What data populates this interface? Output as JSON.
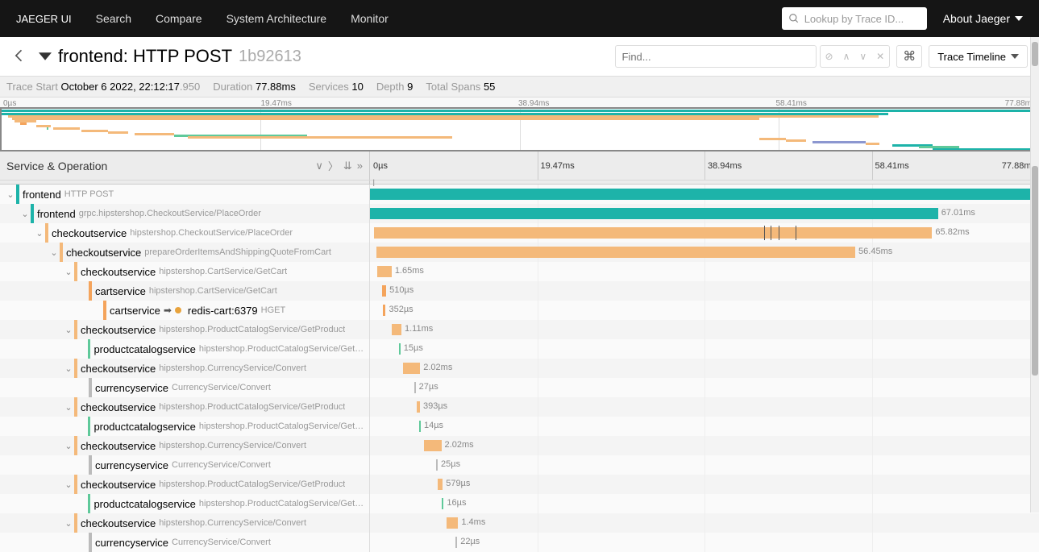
{
  "nav": {
    "brand": "JAEGER UI",
    "items": [
      "Search",
      "Compare",
      "System Architecture",
      "Monitor"
    ],
    "lookup_placeholder": "Lookup by Trace ID...",
    "about": "About Jaeger"
  },
  "header": {
    "title": "frontend: HTTP POST",
    "trace_id": "1b92613",
    "find_placeholder": "Find...",
    "view_mode": "Trace Timeline"
  },
  "info": {
    "start_label": "Trace Start",
    "start_value": "October 6 2022, 22:12:17",
    "start_ms": ".950",
    "duration_label": "Duration",
    "duration_value": "77.88ms",
    "services_label": "Services",
    "services_value": "10",
    "depth_label": "Depth",
    "depth_value": "9",
    "spans_label": "Total Spans",
    "spans_value": "55"
  },
  "ticks": [
    "0µs",
    "19.47ms",
    "38.94ms",
    "58.41ms",
    "77.88ms"
  ],
  "left_header": "Service & Operation",
  "colors": {
    "teal": "#1db3a9",
    "orange": "#f4b97a",
    "orange2": "#f4a45c",
    "green": "#5fc99a",
    "grey": "#bbb"
  },
  "chart_data": {
    "type": "gantt",
    "x_unit": "ms",
    "x_range": [
      0,
      77.88
    ],
    "spans": [
      {
        "indent": 0,
        "service": "frontend",
        "op": "HTTP POST",
        "color": "teal",
        "start": 0,
        "dur": 77.88,
        "label": ""
      },
      {
        "indent": 1,
        "service": "frontend",
        "op": "grpc.hipstershop.CheckoutService/PlaceOrder",
        "color": "teal",
        "start": 0,
        "dur": 67.01,
        "label": "67.01ms"
      },
      {
        "indent": 2,
        "service": "checkoutservice",
        "op": "hipstershop.CheckoutService/PlaceOrder",
        "color": "orange",
        "start": 0.5,
        "dur": 65.82,
        "label": "65.82ms",
        "logs": [
          46.5,
          47.3,
          48.2,
          50.2
        ]
      },
      {
        "indent": 3,
        "service": "checkoutservice",
        "op": "prepareOrderItemsAndShippingQuoteFromCart",
        "color": "orange",
        "start": 0.8,
        "dur": 56.45,
        "label": "56.45ms"
      },
      {
        "indent": 4,
        "service": "checkoutservice",
        "op": "hipstershop.CartService/GetCart",
        "color": "orange",
        "start": 0.9,
        "dur": 1.65,
        "label": "1.65ms"
      },
      {
        "indent": 5,
        "service": "cartservice",
        "op": "hipstershop.CartService/GetCart",
        "color": "orange2",
        "start": 1.4,
        "dur": 0.51,
        "label": "510µs"
      },
      {
        "indent": 6,
        "service": "cartservice",
        "op": "HGET",
        "color": "orange2",
        "link": "redis-cart:6379",
        "start": 1.5,
        "dur": 0.352,
        "label": "352µs"
      },
      {
        "indent": 4,
        "service": "checkoutservice",
        "op": "hipstershop.ProductCatalogService/GetProduct",
        "color": "orange",
        "start": 2.6,
        "dur": 1.11,
        "label": "1.11ms"
      },
      {
        "indent": 5,
        "service": "productcatalogservice",
        "op": "hipstershop.ProductCatalogService/GetProduct",
        "color": "green",
        "start": 3.4,
        "dur": 0.015,
        "label": "15µs"
      },
      {
        "indent": 4,
        "service": "checkoutservice",
        "op": "hipstershop.CurrencyService/Convert",
        "color": "orange",
        "start": 3.9,
        "dur": 2.02,
        "label": "2.02ms"
      },
      {
        "indent": 5,
        "service": "currencyservice",
        "op": "CurrencyService/Convert",
        "color": "grey",
        "start": 5.2,
        "dur": 0.027,
        "label": "27µs"
      },
      {
        "indent": 4,
        "service": "checkoutservice",
        "op": "hipstershop.ProductCatalogService/GetProduct",
        "color": "orange",
        "start": 5.5,
        "dur": 0.393,
        "label": "393µs"
      },
      {
        "indent": 5,
        "service": "productcatalogservice",
        "op": "hipstershop.ProductCatalogService/GetProduct",
        "color": "green",
        "start": 5.8,
        "dur": 0.014,
        "label": "14µs"
      },
      {
        "indent": 4,
        "service": "checkoutservice",
        "op": "hipstershop.CurrencyService/Convert",
        "color": "orange",
        "start": 6.4,
        "dur": 2.02,
        "label": "2.02ms"
      },
      {
        "indent": 5,
        "service": "currencyservice",
        "op": "CurrencyService/Convert",
        "color": "grey",
        "start": 7.8,
        "dur": 0.025,
        "label": "25µs"
      },
      {
        "indent": 4,
        "service": "checkoutservice",
        "op": "hipstershop.ProductCatalogService/GetProduct",
        "color": "orange",
        "start": 8.0,
        "dur": 0.579,
        "label": "579µs"
      },
      {
        "indent": 5,
        "service": "productcatalogservice",
        "op": "hipstershop.ProductCatalogService/GetProduct",
        "color": "green",
        "start": 8.5,
        "dur": 0.016,
        "label": "16µs"
      },
      {
        "indent": 4,
        "service": "checkoutservice",
        "op": "hipstershop.CurrencyService/Convert",
        "color": "orange",
        "start": 9.0,
        "dur": 1.4,
        "label": "1.4ms"
      },
      {
        "indent": 5,
        "service": "currencyservice",
        "op": "CurrencyService/Convert",
        "color": "grey",
        "start": 10.1,
        "dur": 0.022,
        "label": "22µs"
      }
    ]
  },
  "minimap_spans": [
    {
      "color": "teal",
      "start": 0,
      "dur": 77.88,
      "y": 1
    },
    {
      "color": "teal",
      "start": 0,
      "dur": 67.01,
      "y": 5
    },
    {
      "color": "orange",
      "start": 0.5,
      "dur": 65.82,
      "y": 8
    },
    {
      "color": "orange",
      "start": 0.8,
      "dur": 56.45,
      "y": 11
    },
    {
      "color": "orange",
      "start": 1,
      "dur": 1.6,
      "y": 14
    },
    {
      "color": "orange2",
      "start": 1.4,
      "dur": 0.5,
      "y": 17
    },
    {
      "color": "orange",
      "start": 2.6,
      "dur": 1.1,
      "y": 20
    },
    {
      "color": "green",
      "start": 3.4,
      "dur": 0.1,
      "y": 23
    },
    {
      "color": "orange",
      "start": 3.9,
      "dur": 2,
      "y": 23
    },
    {
      "color": "orange",
      "start": 6,
      "dur": 2,
      "y": 26
    },
    {
      "color": "orange",
      "start": 8,
      "dur": 1.5,
      "y": 28
    },
    {
      "color": "orange",
      "start": 10,
      "dur": 3,
      "y": 30
    },
    {
      "color": "green",
      "start": 13,
      "dur": 10,
      "y": 32
    },
    {
      "color": "orange",
      "start": 14,
      "dur": 20,
      "y": 34
    },
    {
      "color": "orange",
      "start": 57,
      "dur": 2,
      "y": 36
    },
    {
      "color": "orange",
      "start": 59,
      "dur": 1.5,
      "y": 38
    },
    {
      "color": "#8c97d0",
      "start": 61,
      "dur": 4,
      "y": 40
    },
    {
      "color": "orange",
      "start": 65,
      "dur": 1,
      "y": 42
    },
    {
      "color": "teal",
      "start": 67,
      "dur": 3,
      "y": 44
    },
    {
      "color": "green",
      "start": 69,
      "dur": 3,
      "y": 46
    },
    {
      "color": "teal",
      "start": 70,
      "dur": 7.8,
      "y": 49
    },
    {
      "color": "green",
      "start": 71,
      "dur": 6.5,
      "y": 52
    }
  ]
}
